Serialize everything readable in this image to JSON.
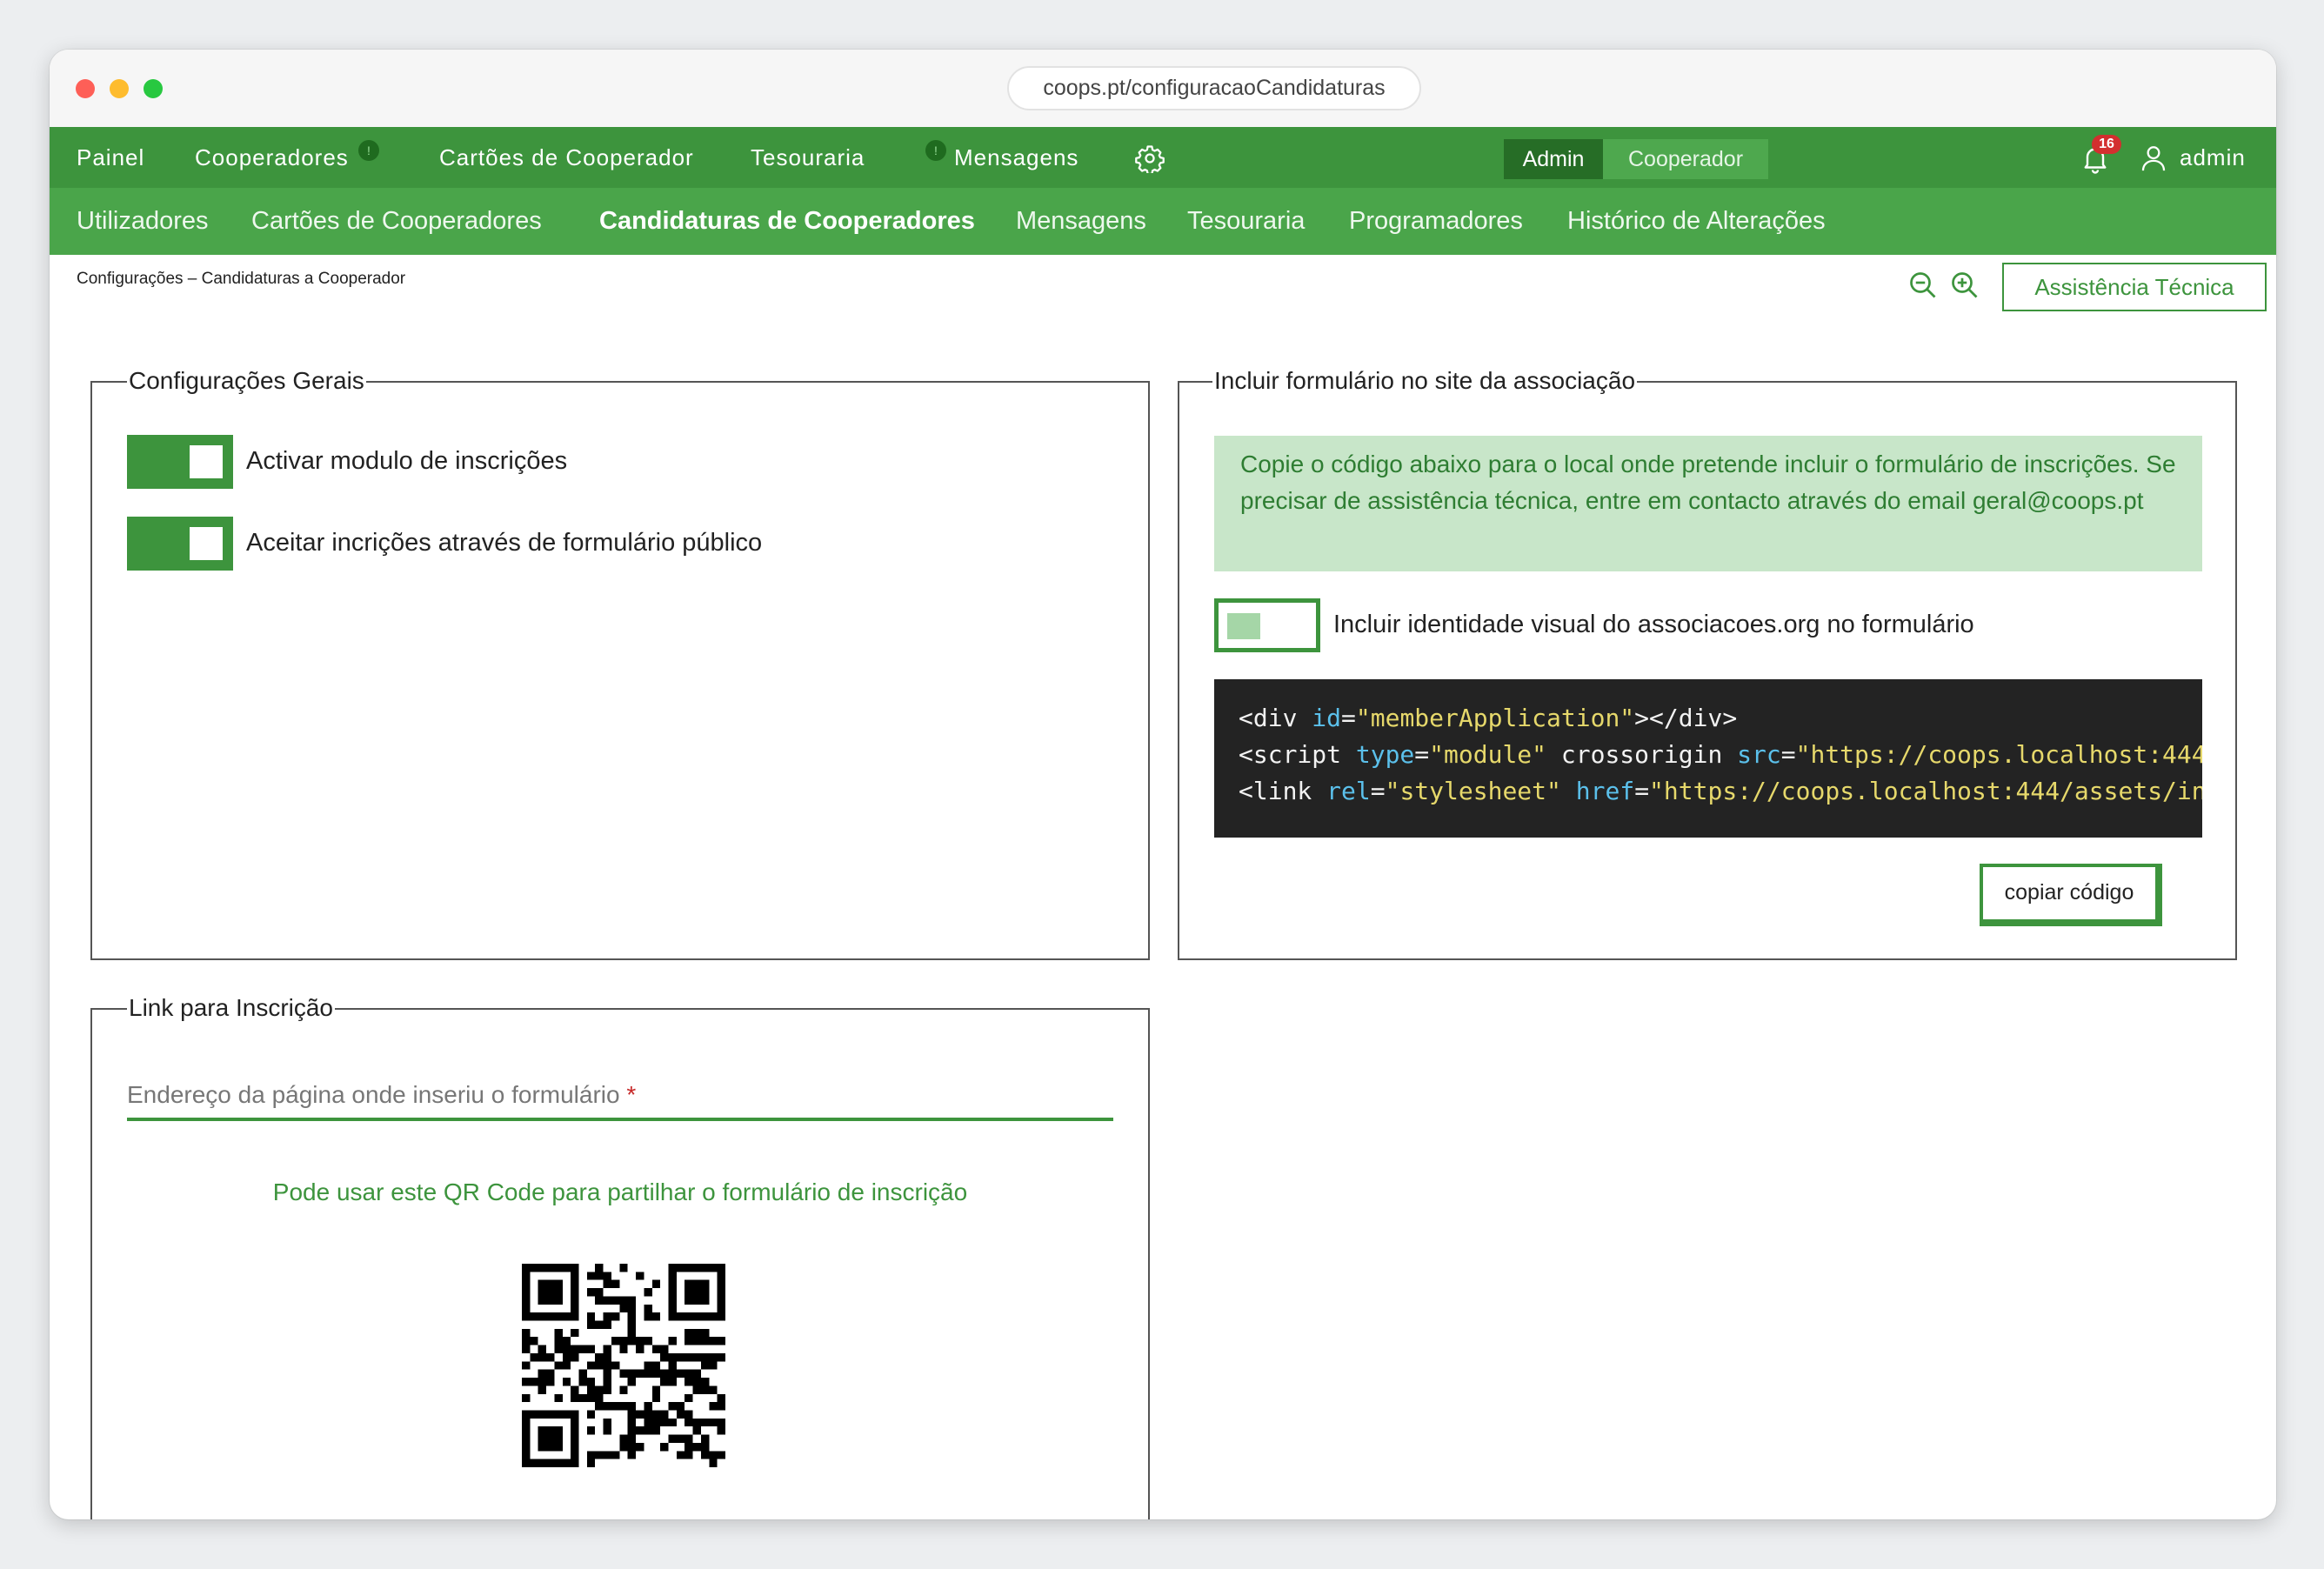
{
  "browser": {
    "url": "coops.pt/configuracaoCandidaturas"
  },
  "topnav": {
    "items": [
      {
        "label": "Painel"
      },
      {
        "label": "Cooperadores",
        "badge": "!"
      },
      {
        "label": "Cartões de Cooperador"
      },
      {
        "label": "Tesouraria",
        "badge": "!"
      },
      {
        "label": "Mensagens"
      }
    ],
    "settings_icon": "gear-icon",
    "mode_switch": {
      "admin": "Admin",
      "cooperador": "Cooperador",
      "selected": "Admin"
    },
    "notifications_count": "16",
    "user": "admin"
  },
  "subnav": {
    "items": [
      {
        "label": "Utilizadores"
      },
      {
        "label": "Cartões de Cooperadores"
      },
      {
        "label": "Candidaturas de Cooperadores",
        "active": true
      },
      {
        "label": "Mensagens"
      },
      {
        "label": "Tesouraria"
      },
      {
        "label": "Programadores"
      },
      {
        "label": "Histórico de Alterações"
      }
    ]
  },
  "breadcrumb": "Configurações – Candidaturas a Cooperador",
  "toolbar": {
    "assist_label": "Assistência Técnica"
  },
  "general": {
    "title": "Configurações Gerais",
    "toggles": [
      {
        "label": "Activar modulo de inscrições",
        "on": true
      },
      {
        "label": "Aceitar incrições através de formulário público",
        "on": true
      }
    ]
  },
  "embed": {
    "title": "Incluir formulário no site da associação",
    "info": "Copie o código abaixo para o local onde pretende incluir o formulário de inscrições. Se precisar de assistência técnica, entre em contacto através do email geral@coops.pt",
    "branding_toggle": {
      "label": "Incluir identidade visual do associacoes.org no formulário",
      "on": false
    },
    "code_lines": [
      "<div id=\"memberApplication\"></div>",
      "<script type=\"module\" crossorigin src=\"https://coops.localhost:444",
      "<link rel=\"stylesheet\" href=\"https://coops.localhost:444/assets/in"
    ],
    "copy_label": "copiar código"
  },
  "signup_link": {
    "title": "Link para Inscrição",
    "placeholder": "Endereço da página onde inseriu o formulário",
    "required_mark": "*",
    "qr_hint": "Pode usar este QR Code para partilhar o formulário de inscrição"
  },
  "colors": {
    "primary_green": "#3d943d",
    "subnav_green": "#4aa54a",
    "info_bg": "#c8e6c9",
    "code_bg": "#232323",
    "badge_red": "#d32f2f"
  }
}
